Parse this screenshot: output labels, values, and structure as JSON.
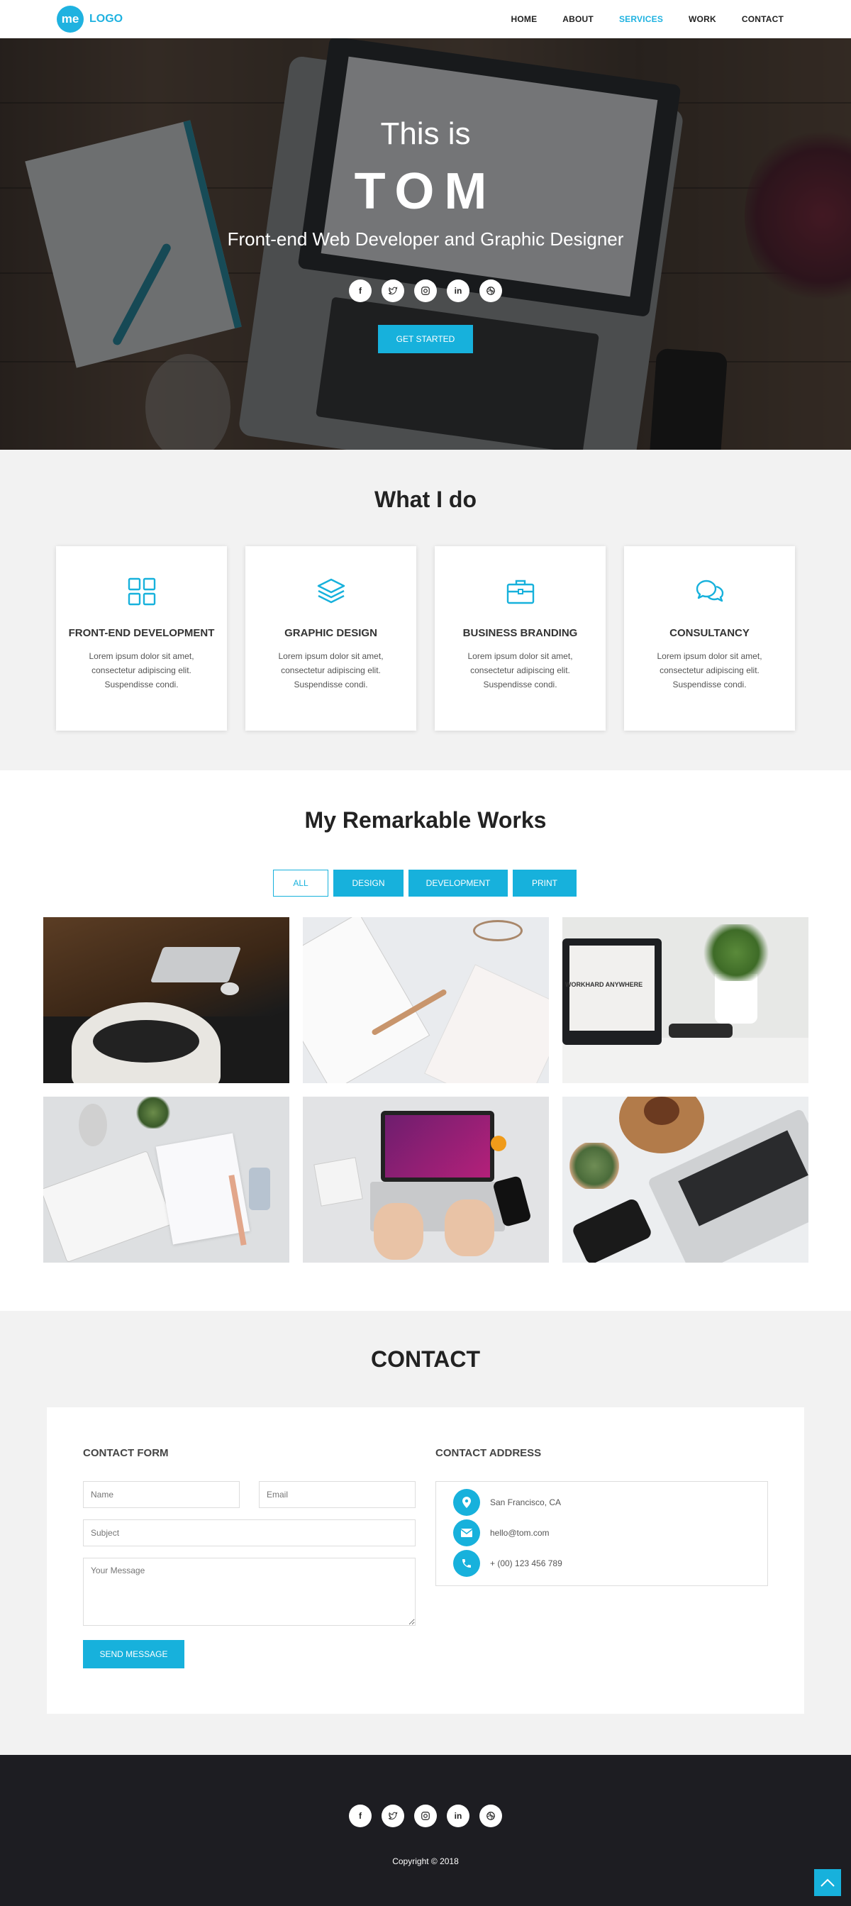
{
  "nav": {
    "logo_mark": "me",
    "logo_text": "LOGO",
    "items": [
      {
        "label": "HOME"
      },
      {
        "label": "ABOUT"
      },
      {
        "label": "SERVICES"
      },
      {
        "label": "WORK"
      },
      {
        "label": "CONTACT"
      }
    ],
    "active": "SERVICES"
  },
  "hero": {
    "pre": "This is",
    "name": "TOM",
    "subtitle": "Front-end Web Developer and Graphic Designer",
    "cta": "GET STARTED",
    "social": [
      "facebook-icon",
      "twitter-icon",
      "instagram-icon",
      "linkedin-icon",
      "dribbble-icon"
    ]
  },
  "services": {
    "title": "What I do",
    "cards": [
      {
        "icon": "grid-icon",
        "title": "FRONT-END DEVELOPMENT",
        "text": "Lorem ipsum dolor sit amet, consectetur adipiscing elit. Suspendisse condi."
      },
      {
        "icon": "layers-icon",
        "title": "GRAPHIC DESIGN",
        "text": "Lorem ipsum dolor sit amet, consectetur adipiscing elit. Suspendisse condi."
      },
      {
        "icon": "briefcase-icon",
        "title": "BUSINESS BRANDING",
        "text": "Lorem ipsum dolor sit amet, consectetur adipiscing elit. Suspendisse condi."
      },
      {
        "icon": "chat-icon",
        "title": "CONSULTANCY",
        "text": "Lorem ipsum dolor sit amet, consectetur adipiscing elit. Suspendisse condi."
      }
    ]
  },
  "works": {
    "title": "My Remarkable Works",
    "filters": [
      "ALL",
      "DESIGN",
      "DEVELOPMENT",
      "PRINT"
    ],
    "active_filter": "ALL",
    "laptop_sticker": "WORKHARD ANYWHERE"
  },
  "contact": {
    "title": "CONTACT",
    "form_title": "CONTACT FORM",
    "name_placeholder": "Name",
    "email_placeholder": "Email",
    "subject_placeholder": "Subject",
    "message_placeholder": "Your Message",
    "send_label": "SEND MESSAGE",
    "address_title": "CONTACT ADDRESS",
    "address": "San Francisco, CA",
    "email": "hello@tom.com",
    "phone": "+ (00) 123 456 789"
  },
  "footer": {
    "copyright": "Copyright © 2018",
    "social": [
      "facebook-icon",
      "twitter-icon",
      "instagram-icon",
      "linkedin-icon",
      "dribbble-icon"
    ]
  },
  "colors": {
    "accent": "#17b1dc",
    "footer_bg": "#1d1d22",
    "section_bg": "#f2f2f2"
  }
}
